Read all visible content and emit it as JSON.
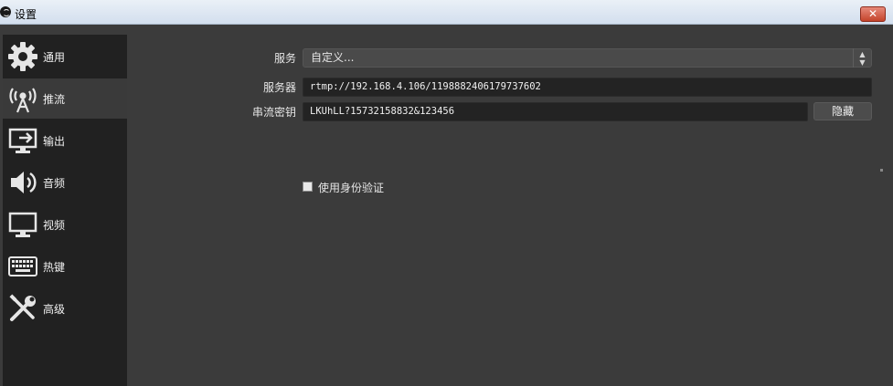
{
  "window": {
    "title": "设置",
    "close_glyph": "✕"
  },
  "sidebar": {
    "items": [
      {
        "label": "通用",
        "icon": "gear-icon",
        "active": false
      },
      {
        "label": "推流",
        "icon": "broadcast-tower-icon",
        "active": true
      },
      {
        "label": "输出",
        "icon": "monitor-output-icon",
        "active": false
      },
      {
        "label": "音频",
        "icon": "speaker-icon",
        "active": false
      },
      {
        "label": "视频",
        "icon": "monitor-icon",
        "active": false
      },
      {
        "label": "热键",
        "icon": "keyboard-icon",
        "active": false
      },
      {
        "label": "高级",
        "icon": "tools-icon",
        "active": false
      }
    ]
  },
  "stream": {
    "service_label": "服务",
    "service_value": "自定义...",
    "server_label": "服务器",
    "server_value": "rtmp://192.168.4.106/1198882406179737602",
    "key_label": "串流密钥",
    "key_value": "LKUhLL?15732158832&123456",
    "hide_button": "隐藏",
    "use_auth_label": "使用身份验证",
    "use_auth_checked": false
  },
  "colors": {
    "background": "#3b3b3b",
    "sidebar": "#212121",
    "active_item": "#3a3a3a",
    "field": "#232323"
  }
}
